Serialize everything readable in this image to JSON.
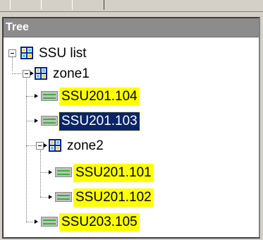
{
  "panel": {
    "title": "Tree"
  },
  "tree": {
    "root": {
      "label": "SSU list"
    },
    "zone1": {
      "label": "zone1"
    },
    "zone2": {
      "label": "zone2"
    },
    "items": {
      "ssu_201_104": {
        "label": "SSU201.104"
      },
      "ssu_201_103": {
        "label": "SSU201.103"
      },
      "ssu_201_101": {
        "label": "SSU201.101"
      },
      "ssu_201_102": {
        "label": "SSU201.102"
      },
      "ssu_203_105": {
        "label": "SSU203.105"
      }
    }
  },
  "colors": {
    "highlight": "#ffff00",
    "selection": "#0a246a",
    "header": "#8c8c8c"
  },
  "icons": [
    "expander-minus-icon",
    "group-icon",
    "device-icon",
    "arrow-icon"
  ]
}
